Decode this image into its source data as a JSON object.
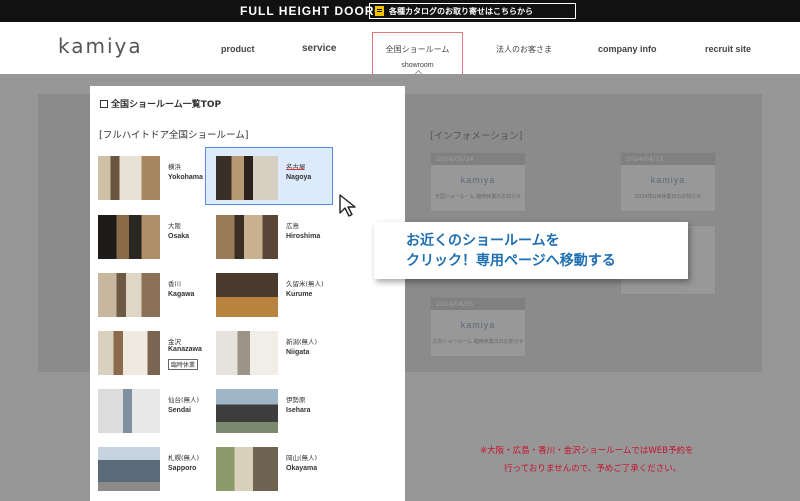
{
  "topbar": {
    "brand": "FULL HEIGHT DOOR®",
    "catalog_label": "各種カタログのお取り寄せはこちらから"
  },
  "header": {
    "logo": "kamiya",
    "nav": [
      {
        "label": "product"
      },
      {
        "label": "service"
      },
      {
        "label": "全国ショールーム",
        "sub": "showroom"
      },
      {
        "label": "法人のお客さま"
      },
      {
        "label": "company info"
      },
      {
        "label": "recruit site"
      }
    ]
  },
  "panel": {
    "top_link": "全国ショールーム一覧TOP",
    "section_title": "[フルハイトドア全国ショールーム]",
    "showrooms": [
      {
        "city": "横浜",
        "en": "Yokohama"
      },
      {
        "city": "名古屋",
        "en": "Nagoya"
      },
      {
        "city": "大阪",
        "en": "Osaka"
      },
      {
        "city": "広島",
        "en": "Hiroshima"
      },
      {
        "city": "香川",
        "en": "Kagawa"
      },
      {
        "city": "久留米(無人)",
        "en": "Kurume"
      },
      {
        "city": "金沢",
        "en": "Kanazawa",
        "tag": "臨時休業"
      },
      {
        "city": "新潟(無人)",
        "en": "Niigata"
      },
      {
        "city": "仙台(無人)",
        "en": "Sendai"
      },
      {
        "city": "伊勢原",
        "en": "Isehara"
      },
      {
        "city": "札幌(無人)",
        "en": "Sapporo"
      },
      {
        "city": "岡山(無人)",
        "en": "Okayama"
      }
    ]
  },
  "info": {
    "title": "[インフォメーション]",
    "cards": [
      {
        "date": "2024/05/24",
        "logo": "kamiya",
        "text": "全国ショールーム 臨時休業のお知らせ"
      },
      {
        "date": "2024/04/15",
        "logo": "kamiya",
        "text": "2024年GW休業日のお知らせ"
      },
      {
        "date": "2024/04/05",
        "logo": "kamiya",
        "text": "広島ショールーム 臨時休業日のお知らせ"
      }
    ]
  },
  "callout": {
    "line1": "お近くのショールームを",
    "line2": "クリック！専用ページへ移動する"
  },
  "note": {
    "line1": "※大阪・広島・香川・金沢ショールームではWEB予約を",
    "line2": "行っておりませんので、予めご了承ください。"
  },
  "colors": {
    "accent_blue": "#1f6fb2",
    "note_red": "#c8102e",
    "active_border": "#e07a7a"
  }
}
